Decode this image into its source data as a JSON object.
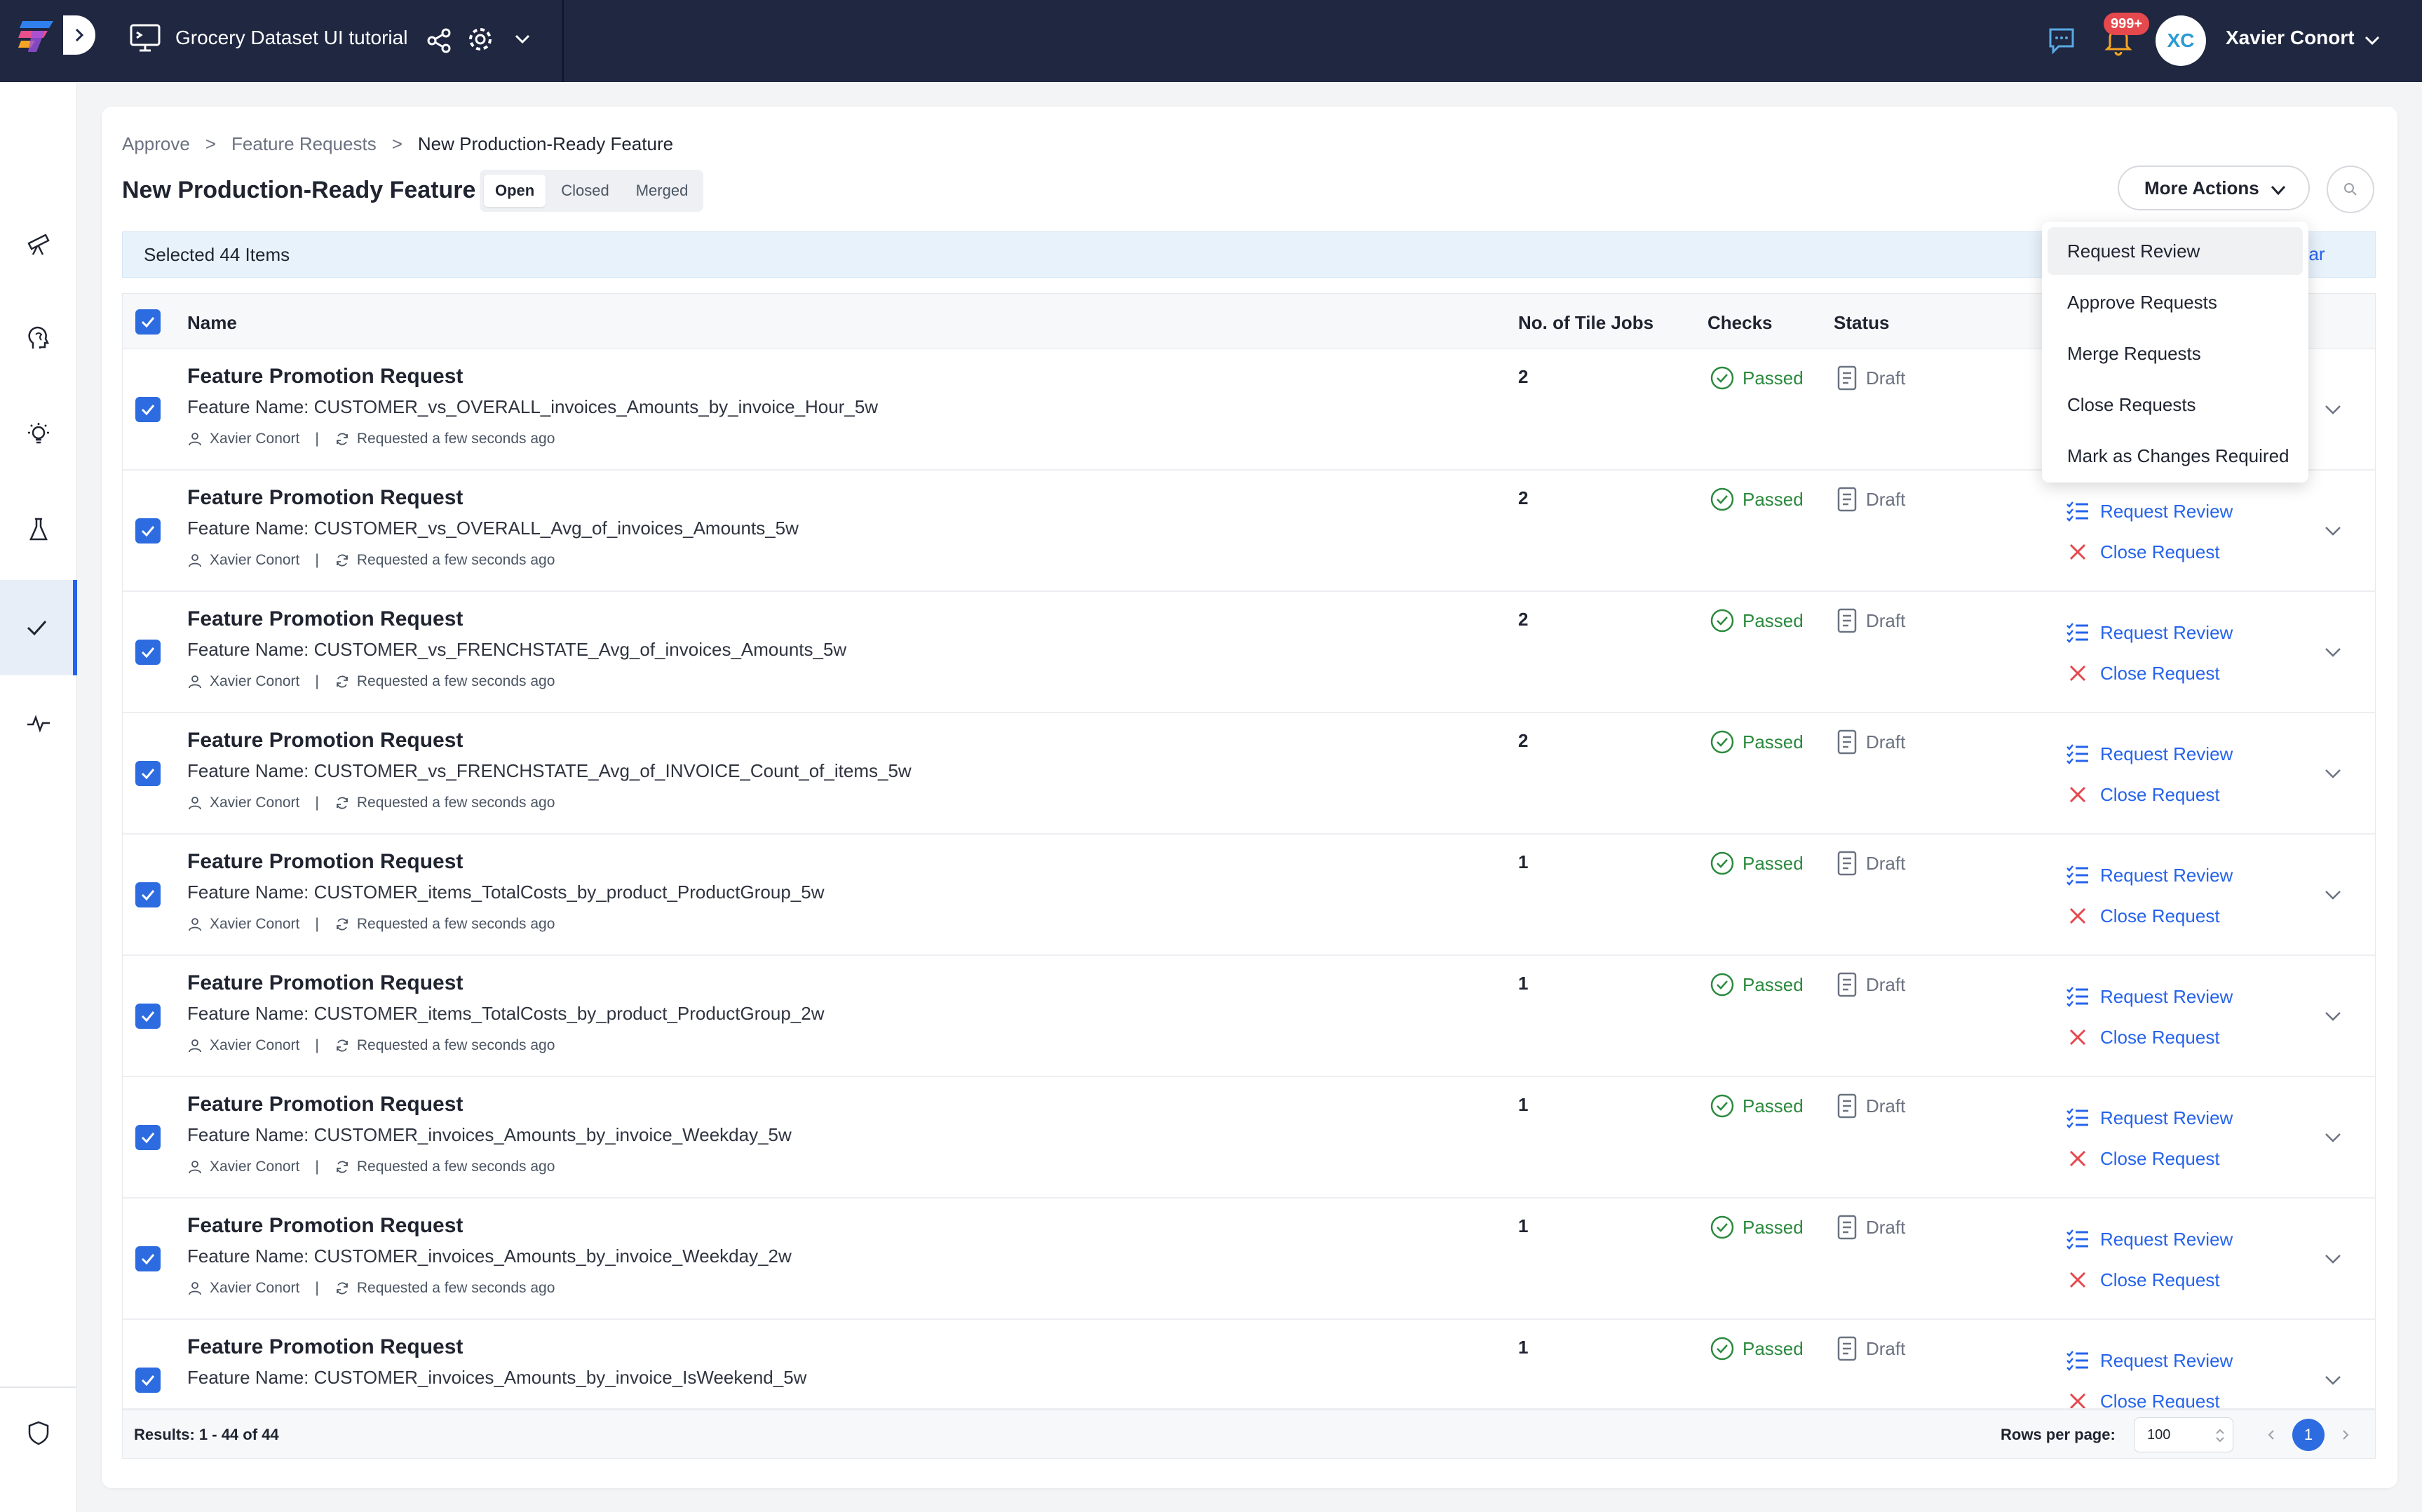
{
  "header": {
    "app_title": "Grocery Dataset UI tutorial",
    "notification_count": "999+",
    "user_initials": "XC",
    "user_name": "Xavier Conort"
  },
  "sidebar": {
    "items": [
      {
        "icon": "telescope-icon"
      },
      {
        "icon": "brain-icon"
      },
      {
        "icon": "lightbulb-icon"
      },
      {
        "icon": "flask-icon"
      },
      {
        "icon": "check-icon",
        "active": true
      },
      {
        "icon": "activity-icon"
      }
    ],
    "bottom_items": [
      {
        "icon": "shield-icon"
      },
      {
        "icon": "user-search-icon"
      }
    ]
  },
  "breadcrumb": {
    "items": [
      "Approve",
      "Feature Requests",
      "New Production-Ready Feature"
    ],
    "separator": ">"
  },
  "page": {
    "title": "New Production-Ready Feature",
    "tabs": [
      "Open",
      "Closed",
      "Merged"
    ],
    "active_tab": "Open",
    "more_actions_label": "More Actions"
  },
  "selection": {
    "text": "Selected 44 Items",
    "clear_label_visible": "ear"
  },
  "table": {
    "columns": {
      "name": "Name",
      "jobs": "No. of Tile Jobs",
      "checks": "Checks",
      "status": "Status"
    },
    "rows": [
      {
        "title": "Feature Promotion Request",
        "feature": "Feature Name: CUSTOMER_vs_OVERALL_invoices_Amounts_by_invoice_Hour_5w",
        "user": "Xavier Conort",
        "requested": "Requested a few seconds ago",
        "jobs": "2",
        "check": "Passed",
        "status": "Draft",
        "action1": "",
        "action2": ""
      },
      {
        "title": "Feature Promotion Request",
        "feature": "Feature Name: CUSTOMER_vs_OVERALL_Avg_of_invoices_Amounts_5w",
        "user": "Xavier Conort",
        "requested": "Requested a few seconds ago",
        "jobs": "2",
        "check": "Passed",
        "status": "Draft",
        "action1": "Request Review",
        "action2": "Close Request"
      },
      {
        "title": "Feature Promotion Request",
        "feature": "Feature Name: CUSTOMER_vs_FRENCHSTATE_Avg_of_invoices_Amounts_5w",
        "user": "Xavier Conort",
        "requested": "Requested a few seconds ago",
        "jobs": "2",
        "check": "Passed",
        "status": "Draft",
        "action1": "Request Review",
        "action2": "Close Request"
      },
      {
        "title": "Feature Promotion Request",
        "feature": "Feature Name: CUSTOMER_vs_FRENCHSTATE_Avg_of_INVOICE_Count_of_items_5w",
        "user": "Xavier Conort",
        "requested": "Requested a few seconds ago",
        "jobs": "2",
        "check": "Passed",
        "status": "Draft",
        "action1": "Request Review",
        "action2": "Close Request"
      },
      {
        "title": "Feature Promotion Request",
        "feature": "Feature Name: CUSTOMER_items_TotalCosts_by_product_ProductGroup_5w",
        "user": "Xavier Conort",
        "requested": "Requested a few seconds ago",
        "jobs": "1",
        "check": "Passed",
        "status": "Draft",
        "action1": "Request Review",
        "action2": "Close Request"
      },
      {
        "title": "Feature Promotion Request",
        "feature": "Feature Name: CUSTOMER_items_TotalCosts_by_product_ProductGroup_2w",
        "user": "Xavier Conort",
        "requested": "Requested a few seconds ago",
        "jobs": "1",
        "check": "Passed",
        "status": "Draft",
        "action1": "Request Review",
        "action2": "Close Request"
      },
      {
        "title": "Feature Promotion Request",
        "feature": "Feature Name: CUSTOMER_invoices_Amounts_by_invoice_Weekday_5w",
        "user": "Xavier Conort",
        "requested": "Requested a few seconds ago",
        "jobs": "1",
        "check": "Passed",
        "status": "Draft",
        "action1": "Request Review",
        "action2": "Close Request"
      },
      {
        "title": "Feature Promotion Request",
        "feature": "Feature Name: CUSTOMER_invoices_Amounts_by_invoice_Weekday_2w",
        "user": "Xavier Conort",
        "requested": "Requested a few seconds ago",
        "jobs": "1",
        "check": "Passed",
        "status": "Draft",
        "action1": "Request Review",
        "action2": "Close Request"
      },
      {
        "title": "Feature Promotion Request",
        "feature": "Feature Name: CUSTOMER_invoices_Amounts_by_invoice_IsWeekend_5w",
        "user": "",
        "requested": "",
        "jobs": "1",
        "check": "Passed",
        "status": "Draft",
        "action1": "Request Review",
        "action2": "Close Request"
      }
    ]
  },
  "footer": {
    "results": "Results: 1 - 44 of 44",
    "rows_per_page_label": "Rows per page:",
    "rows_per_page": "100",
    "current_page": "1"
  },
  "menu": {
    "items": [
      "Request Review",
      "Approve Requests",
      "Merge Requests",
      "Close Requests",
      "Mark as Changes Required"
    ],
    "highlighted": "Request Review"
  },
  "colors": {
    "header_bg": "#1f2741",
    "accent": "#2563eb",
    "passed": "#2b8a3e",
    "danger": "#e5484d"
  }
}
